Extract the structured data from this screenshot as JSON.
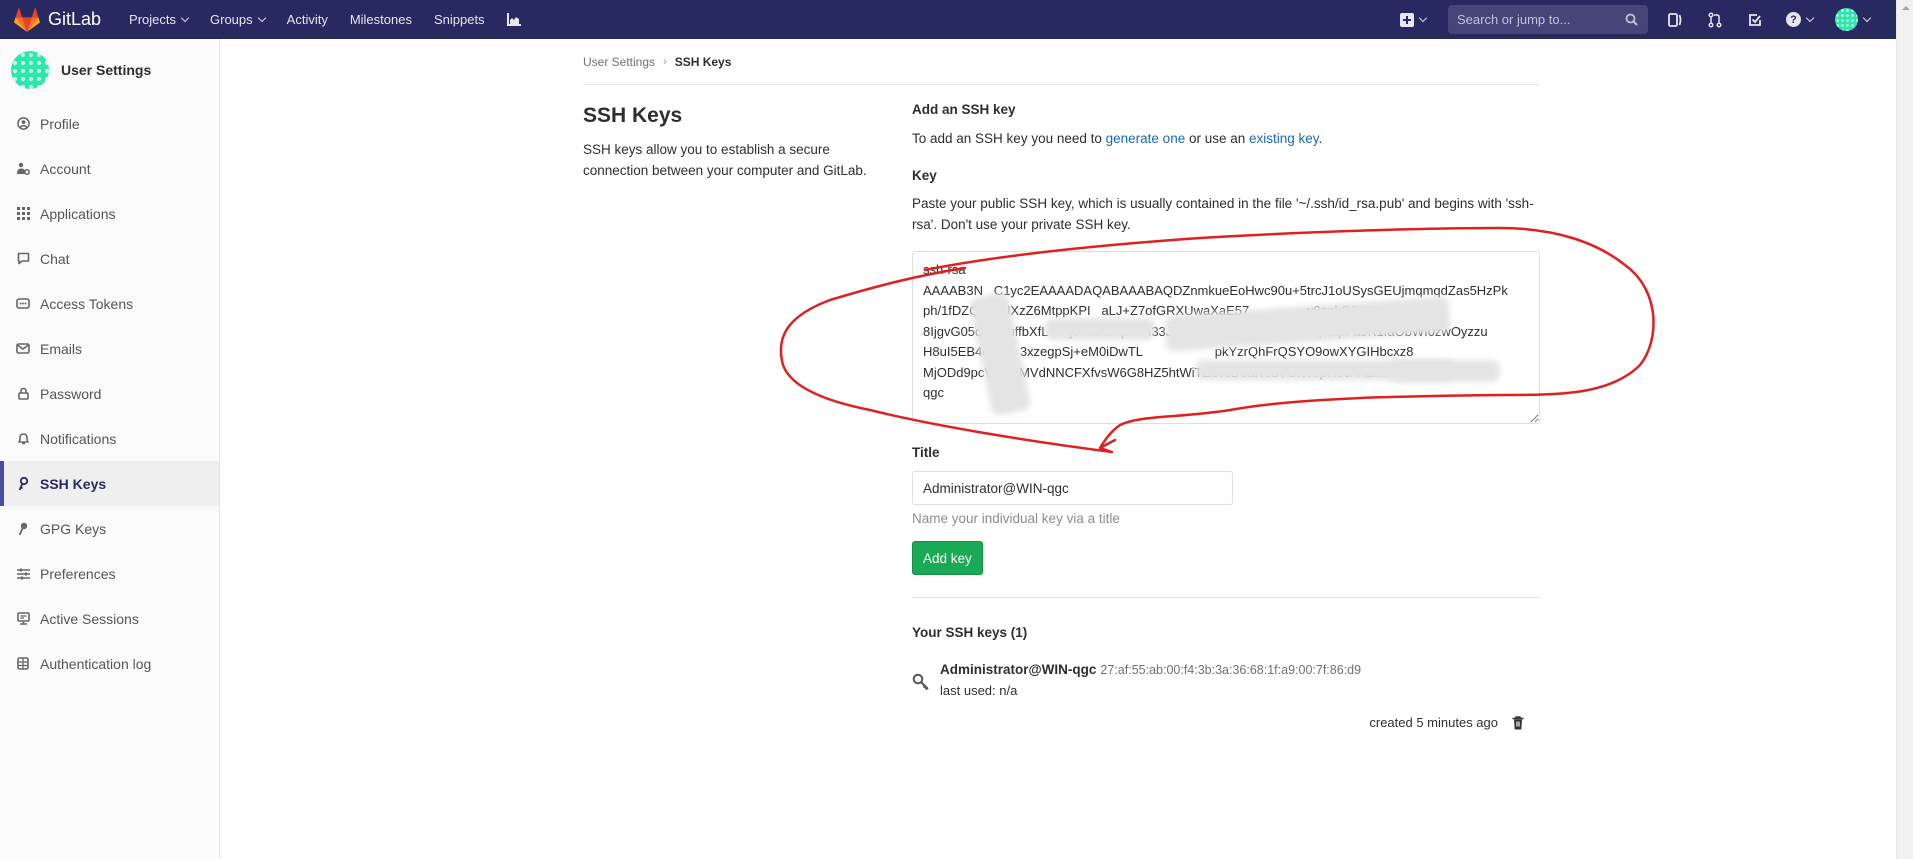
{
  "navbar": {
    "brand": "GitLab",
    "links": [
      {
        "label": "Projects",
        "dropdown": true
      },
      {
        "label": "Groups",
        "dropdown": true
      },
      {
        "label": "Activity",
        "dropdown": false
      },
      {
        "label": "Milestones",
        "dropdown": false
      },
      {
        "label": "Snippets",
        "dropdown": false
      }
    ],
    "chart_icon": "chart-icon",
    "new_icon": "plus-square-icon",
    "search_placeholder": "Search or jump to...",
    "icons": [
      "sidebar-toggle-icon",
      "merge-request-icon",
      "todo-icon",
      "help-icon"
    ],
    "brand_color": "#292961"
  },
  "sidebar": {
    "title": "User Settings",
    "items": [
      {
        "label": "Profile",
        "icon": "profile-icon",
        "active": false
      },
      {
        "label": "Account",
        "icon": "account-icon",
        "active": false
      },
      {
        "label": "Applications",
        "icon": "applications-icon",
        "active": false
      },
      {
        "label": "Chat",
        "icon": "chat-icon",
        "active": false
      },
      {
        "label": "Access Tokens",
        "icon": "token-icon",
        "active": false
      },
      {
        "label": "Emails",
        "icon": "email-icon",
        "active": false
      },
      {
        "label": "Password",
        "icon": "lock-icon",
        "active": false
      },
      {
        "label": "Notifications",
        "icon": "bell-icon",
        "active": false
      },
      {
        "label": "SSH Keys",
        "icon": "key-icon",
        "active": true
      },
      {
        "label": "GPG Keys",
        "icon": "key-icon",
        "active": false
      },
      {
        "label": "Preferences",
        "icon": "sliders-icon",
        "active": false
      },
      {
        "label": "Active Sessions",
        "icon": "monitor-icon",
        "active": false
      },
      {
        "label": "Authentication log",
        "icon": "log-icon",
        "active": false
      }
    ]
  },
  "breadcrumb": {
    "parent": "User Settings",
    "separator": "›",
    "current": "SSH Keys"
  },
  "page": {
    "title": "SSH Keys",
    "description": "SSH keys allow you to establish a secure connection between your computer and GitLab."
  },
  "form": {
    "section_title": "Add an SSH key",
    "intro_prefix": "To add an SSH key you need to ",
    "intro_link1": "generate one",
    "intro_middle": " or use an ",
    "intro_link2": "existing key",
    "intro_suffix": ".",
    "key_label": "Key",
    "key_help": "Paste your public SSH key, which is usually contained in the file '~/.ssh/id_rsa.pub' and begins with 'ssh-rsa'. Don't use your private SSH key.",
    "key_value": "ssh-rsa\nAAAAB3N   C1yc2EAAAADAQABAAABAQDZnmkueEoHwc90u+5trcJ1oUSysGEUjmqmqdZas5HzPk\nph/1fDZQI   uUXzZ6MtppKPI   aLJ+Z7ofGRXUwaXaE57                y9zokORHBIUt\n8IjgvG05qde   hffbXfL      jcTMHJhpiXFI33JFJacXi+If73NPc2drOalabjNspFa9K1IaObWI0zwOyzzu\nH8uI5EB4ov/w   3xzegpSj+eM0iDwTL                    pkYzrQhFrQSYO9owXYGIHbcxz8\nMjODd9pcV/ecXMVdNNCFXfvsW6G8HZ5htWiTZUI6D6aN8uVCIoKIpITc6/ Administ           N-\nqgc",
    "title_label": "Title",
    "title_value": "Administrator@WIN-qgc",
    "title_hint": "Name your individual key via a title",
    "submit_label": "Add key",
    "submit_color": "#1aaa55"
  },
  "keys": {
    "heading": "Your SSH keys (1)",
    "items": [
      {
        "title": "Administrator@WIN-qgc",
        "fingerprint": "27:af:55:ab:00:f4:3b:3a:36:68:1f:a9:00:7f:86:d9",
        "last_used": "last used: n/a",
        "created": "created 5 minutes ago"
      }
    ]
  },
  "annotation": {
    "color": "#e02020",
    "shape": "hand-drawn-circle-around-key-textarea"
  }
}
